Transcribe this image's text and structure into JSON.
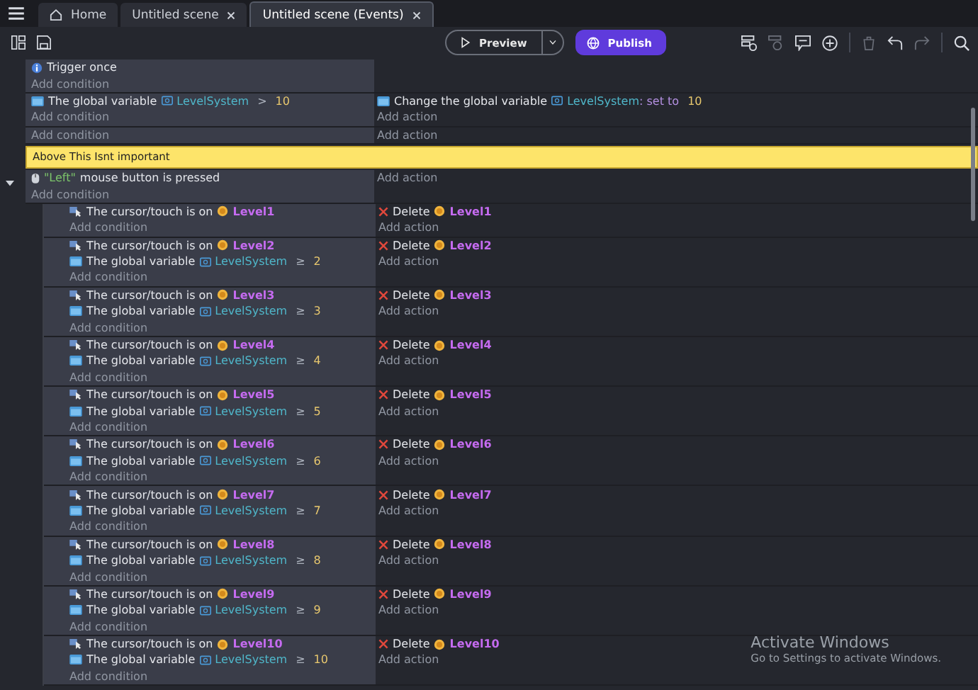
{
  "tabs": [
    {
      "kind": "home",
      "label": "Home",
      "selected": false
    },
    {
      "kind": "scene",
      "label": "Untitled scene",
      "selected": false
    },
    {
      "kind": "scene",
      "label": "Untitled scene (Events)",
      "selected": true
    }
  ],
  "toolbar": {
    "preview": "Preview",
    "publish": "Publish"
  },
  "events": [
    {
      "kind": "standard",
      "conditions": [
        {
          "kind": "trigger",
          "text": "Trigger once"
        }
      ],
      "add_condition": "Add condition"
    },
    {
      "kind": "standard",
      "conditions": [
        {
          "kind": "variable",
          "text": "The global variable",
          "variable": "LevelSystem",
          "operator": ">",
          "value": "10"
        }
      ],
      "actions": [
        {
          "kind": "set_variable",
          "text": "Change the global variable",
          "variable": "LevelSystem",
          "operator": ": set to",
          "value": "10"
        }
      ],
      "add_condition": "Add condition",
      "add_action": "Add action"
    },
    {
      "kind": "standard",
      "add_condition": "Add condition",
      "add_action": "Add action"
    },
    {
      "kind": "comment",
      "text": "Above This Isnt important"
    },
    {
      "kind": "standard",
      "expanded": true,
      "conditions": [
        {
          "kind": "mouse",
          "key": "\"Left\"",
          "text": "mouse button is pressed"
        }
      ],
      "add_condition": "Add condition",
      "add_action": "Add action",
      "children": [
        {
          "kind": "standard",
          "conditions": [
            {
              "kind": "cursor",
              "text": "The cursor/touch is on",
              "object": "Level1"
            }
          ],
          "actions": [
            {
              "kind": "delete",
              "text": "Delete",
              "object": "Level1"
            }
          ],
          "add_condition": "Add condition",
          "add_action": "Add action"
        },
        {
          "kind": "standard",
          "conditions": [
            {
              "kind": "cursor",
              "text": "The cursor/touch is on",
              "object": "Level2"
            },
            {
              "kind": "variable",
              "text": "The global variable",
              "variable": "LevelSystem",
              "operator": "≥",
              "value": "2"
            }
          ],
          "actions": [
            {
              "kind": "delete",
              "text": "Delete",
              "object": "Level2"
            }
          ],
          "add_condition": "Add condition",
          "add_action": "Add action"
        },
        {
          "kind": "standard",
          "conditions": [
            {
              "kind": "cursor",
              "text": "The cursor/touch is on",
              "object": "Level3"
            },
            {
              "kind": "variable",
              "text": "The global variable",
              "variable": "LevelSystem",
              "operator": "≥",
              "value": "3"
            }
          ],
          "actions": [
            {
              "kind": "delete",
              "text": "Delete",
              "object": "Level3"
            }
          ],
          "add_condition": "Add condition",
          "add_action": "Add action"
        },
        {
          "kind": "standard",
          "conditions": [
            {
              "kind": "cursor",
              "text": "The cursor/touch is on",
              "object": "Level4"
            },
            {
              "kind": "variable",
              "text": "The global variable",
              "variable": "LevelSystem",
              "operator": "≥",
              "value": "4"
            }
          ],
          "actions": [
            {
              "kind": "delete",
              "text": "Delete",
              "object": "Level4"
            }
          ],
          "add_condition": "Add condition",
          "add_action": "Add action"
        },
        {
          "kind": "standard",
          "conditions": [
            {
              "kind": "cursor",
              "text": "The cursor/touch is on",
              "object": "Level5"
            },
            {
              "kind": "variable",
              "text": "The global variable",
              "variable": "LevelSystem",
              "operator": "≥",
              "value": "5"
            }
          ],
          "actions": [
            {
              "kind": "delete",
              "text": "Delete",
              "object": "Level5"
            }
          ],
          "add_condition": "Add condition",
          "add_action": "Add action"
        },
        {
          "kind": "standard",
          "conditions": [
            {
              "kind": "cursor",
              "text": "The cursor/touch is on",
              "object": "Level6"
            },
            {
              "kind": "variable",
              "text": "The global variable",
              "variable": "LevelSystem",
              "operator": "≥",
              "value": "6"
            }
          ],
          "actions": [
            {
              "kind": "delete",
              "text": "Delete",
              "object": "Level6"
            }
          ],
          "add_condition": "Add condition",
          "add_action": "Add action"
        },
        {
          "kind": "standard",
          "conditions": [
            {
              "kind": "cursor",
              "text": "The cursor/touch is on",
              "object": "Level7"
            },
            {
              "kind": "variable",
              "text": "The global variable",
              "variable": "LevelSystem",
              "operator": "≥",
              "value": "7"
            }
          ],
          "actions": [
            {
              "kind": "delete",
              "text": "Delete",
              "object": "Level7"
            }
          ],
          "add_condition": "Add condition",
          "add_action": "Add action"
        },
        {
          "kind": "standard",
          "conditions": [
            {
              "kind": "cursor",
              "text": "The cursor/touch is on",
              "object": "Level8"
            },
            {
              "kind": "variable",
              "text": "The global variable",
              "variable": "LevelSystem",
              "operator": "≥",
              "value": "8"
            }
          ],
          "actions": [
            {
              "kind": "delete",
              "text": "Delete",
              "object": "Level8"
            }
          ],
          "add_condition": "Add condition",
          "add_action": "Add action"
        },
        {
          "kind": "standard",
          "conditions": [
            {
              "kind": "cursor",
              "text": "The cursor/touch is on",
              "object": "Level9"
            },
            {
              "kind": "variable",
              "text": "The global variable",
              "variable": "LevelSystem",
              "operator": "≥",
              "value": "9"
            }
          ],
          "actions": [
            {
              "kind": "delete",
              "text": "Delete",
              "object": "Level9"
            }
          ],
          "add_condition": "Add condition",
          "add_action": "Add action"
        },
        {
          "kind": "standard",
          "conditions": [
            {
              "kind": "cursor",
              "text": "The cursor/touch is on",
              "object": "Level10"
            },
            {
              "kind": "variable",
              "text": "The global variable",
              "variable": "LevelSystem",
              "operator": "≥",
              "value": "10"
            }
          ],
          "actions": [
            {
              "kind": "delete",
              "text": "Delete",
              "object": "Level10"
            }
          ],
          "add_condition": "Add condition",
          "add_action": "Add action"
        }
      ]
    }
  ],
  "activation_notice": {
    "title": "Activate Windows",
    "text": "Go to Settings to activate Windows."
  }
}
